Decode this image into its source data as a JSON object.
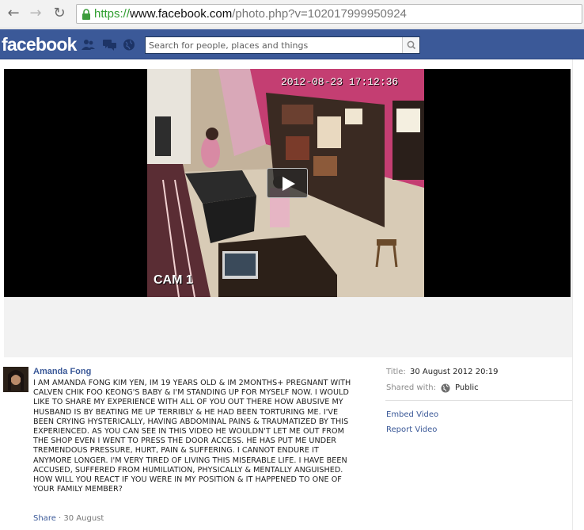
{
  "browser": {
    "url_scheme": "https://",
    "url_host": "www.facebook.com",
    "url_path": "/photo.php?v=102017999950924"
  },
  "header": {
    "logo": "facebook",
    "search_placeholder": "Search for people, places and things",
    "brand_color": "#3b5998"
  },
  "video": {
    "timestamp": "2012-08-23  17:12:36",
    "camera_label": "CAM 1"
  },
  "post": {
    "author": "Amanda Fong",
    "caption": "I AM AMANDA FONG KIM YEN, IM 19 YEARS OLD & IM 2MONTHS+ PREGNANT WITH\nCALVEN CHIK FOO KEONG'S BABY & I'M STANDING UP FOR MYSELF NOW. I WOULD\nLIKE TO SHARE MY EXPERIENCE WITH ALL OF YOU OUT THERE HOW ABUSIVE MY\nHUSBAND IS BY BEATING ME UP TERRIBLY & HE HAD BEEN TORTURING ME. I'VE\nBEEN CRYING HYSTERICALLY, HAVING ABDOMINAL PAINS & TRAUMATIZED BY THIS\nEXPERIENCED. AS YOU CAN SEE IN THIS VIDEO HE WOULDN'T LET ME OUT FROM\nTHE SHOP EVEN I WENT TO PRESS THE DOOR ACCESS. HE HAS PUT ME UNDER\nTREMENDOUS PRESSURE, HURT, PAIN & SUFFERING. I CANNOT ENDURE IT\nANYMORE LONGER. I'M VERY TIRED OF LIVING THIS MISERABLE LIFE. I HAVE BEEN\nACCUSED, SUFFERED FROM HUMILIATION, PHYSICALLY & MENTALLY ANGUISHED.\nHOW WILL YOU REACT IF YOU WERE IN MY POSITION & IT HAPPENED TO ONE OF\nYOUR FAMILY MEMBER?",
    "share_label": "Share",
    "separator": " · ",
    "date": "30 August"
  },
  "meta": {
    "title_label": "Title:",
    "title_value": "30 August 2012 20:19",
    "shared_label": "Shared with:",
    "shared_value": "Public",
    "embed_label": "Embed Video",
    "report_label": "Report Video"
  }
}
